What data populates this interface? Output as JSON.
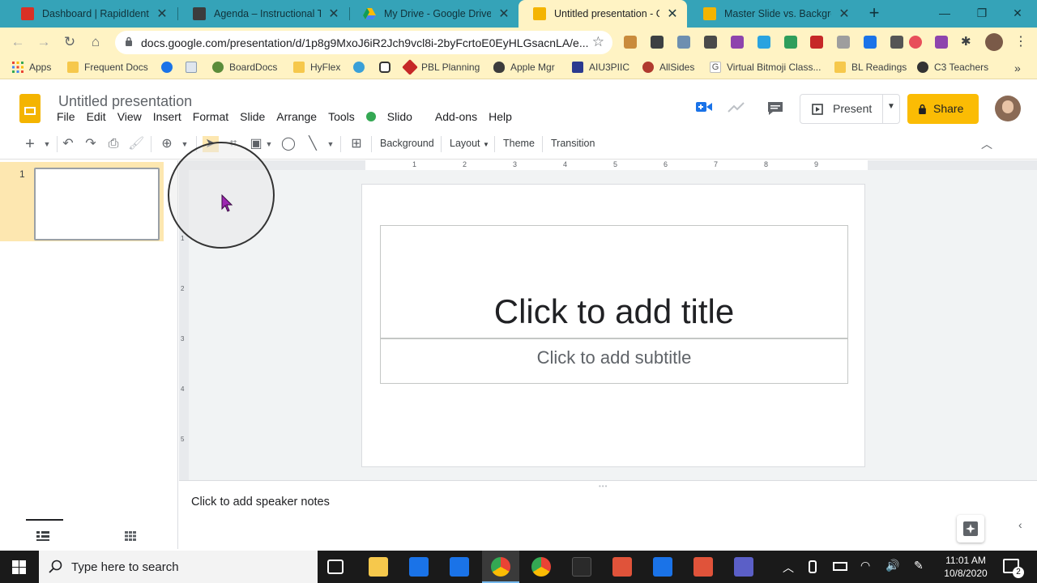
{
  "browser": {
    "tabs": [
      {
        "title": "Dashboard | RapidIdentity",
        "favicon_color": "#d93025"
      },
      {
        "title": "Agenda – Instructional Tech",
        "favicon_color": "#3c3c3c"
      },
      {
        "title": "My Drive - Google Drive",
        "favicon_color": "#1fa463"
      },
      {
        "title": "Untitled presentation - Goo",
        "favicon_color": "#f4b400"
      },
      {
        "title": "Master Slide vs. Backgroun",
        "favicon_color": "#f4b400"
      }
    ],
    "url": "docs.google.com/presentation/d/1p8g9MxoJ6iR2Jch9vcl8i-2byFcrtoE0EyHLGsacnLA/e...",
    "bookmarks": [
      {
        "label": "Apps"
      },
      {
        "label": "Frequent Docs"
      },
      {
        "label": ""
      },
      {
        "label": ""
      },
      {
        "label": "BoardDocs"
      },
      {
        "label": "HyFlex"
      },
      {
        "label": ""
      },
      {
        "label": ""
      },
      {
        "label": "PBL Planning"
      },
      {
        "label": "Apple Mgr"
      },
      {
        "label": "AIU3PIIC"
      },
      {
        "label": "AllSides"
      },
      {
        "label": "Virtual Bitmoji Class..."
      },
      {
        "label": "BL Readings"
      },
      {
        "label": "C3 Teachers"
      }
    ]
  },
  "docs": {
    "title": "Untitled presentation",
    "menu": [
      "File",
      "Edit",
      "View",
      "Insert",
      "Format",
      "Slide",
      "Arrange",
      "Tools",
      "Slido",
      "Add-ons",
      "Help"
    ],
    "present_label": "Present",
    "share_label": "Share"
  },
  "toolbar": {
    "background_label": "Background",
    "layout_label": "Layout",
    "theme_label": "Theme",
    "transition_label": "Transition"
  },
  "filmstrip": {
    "slide_number": "1"
  },
  "ruler_ticks": [
    "1",
    "2",
    "3",
    "4",
    "5",
    "6",
    "7",
    "8",
    "9"
  ],
  "vruler_ticks": [
    "1",
    "2",
    "3",
    "4",
    "5"
  ],
  "slide": {
    "title_placeholder": "Click to add title",
    "subtitle_placeholder": "Click to add subtitle"
  },
  "notes": {
    "placeholder": "Click to add speaker notes"
  },
  "taskbar": {
    "search_placeholder": "Type here to search",
    "time": "11:01 AM",
    "date": "10/8/2020",
    "notification_count": "2"
  },
  "colors": {
    "chrome_frame": "#35a3b8",
    "chrome_toolbar": "#fff3c4",
    "share": "#fbbc04",
    "slides_logo": "#f4b400"
  }
}
